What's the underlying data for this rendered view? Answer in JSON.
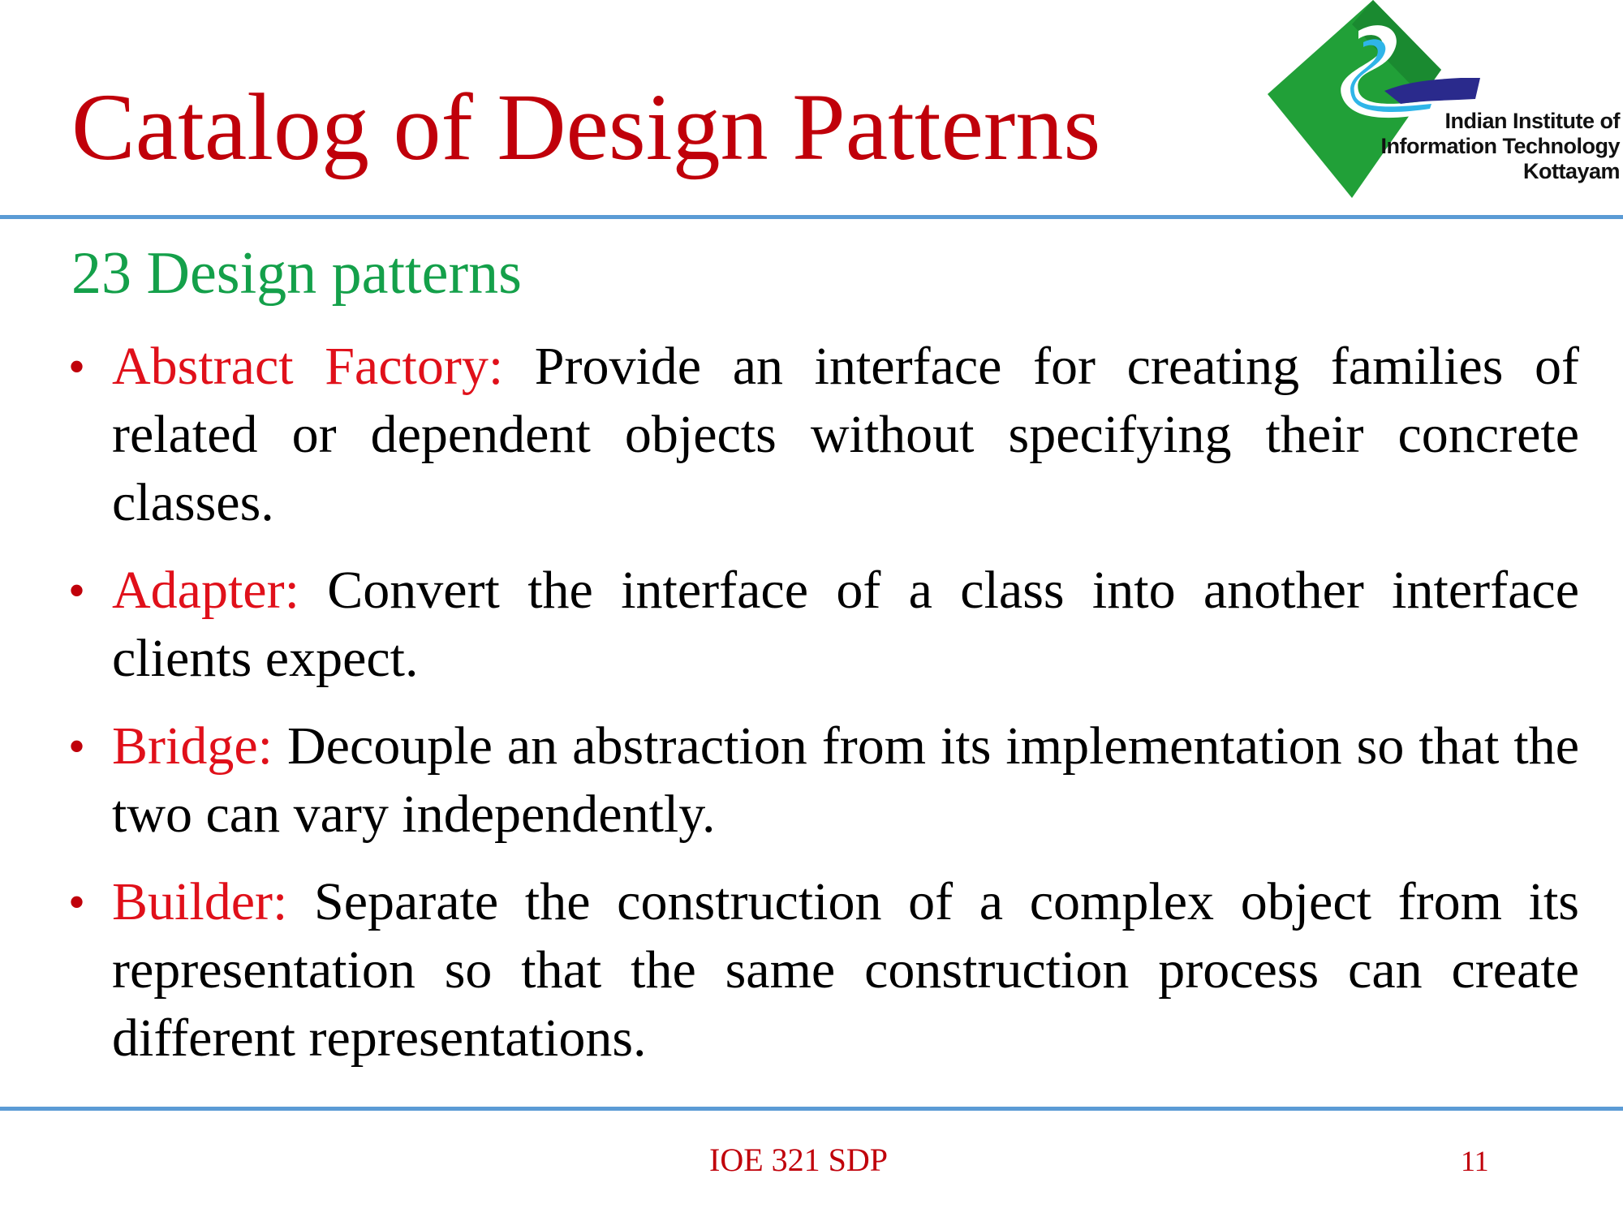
{
  "slide": {
    "title": "Catalog of  Design Patterns",
    "subtitle": "23 Design patterns",
    "logo": {
      "line1": "Indian Institute of",
      "line2": "Information Technology",
      "line3": "Kottayam"
    },
    "bullets": [
      {
        "term": "Abstract Factory:",
        "text": " Provide an interface for creating families of related or dependent objects without specifying their concrete classes."
      },
      {
        "term": "Adapter:",
        "text": " Convert the interface of a class into another interface clients expect."
      },
      {
        "term": "Bridge:",
        "text": " Decouple an abstraction from its implementation so that the two can vary independently."
      },
      {
        "term": "Builder:",
        "text": "  Separate the construction of a complex object from its representation so that the same construction process can create different representations."
      }
    ],
    "footer": {
      "course": "IOE 321 SDP",
      "page_number": "11"
    },
    "colors": {
      "title": "#c0000a",
      "subtitle": "#14a04a",
      "term": "#e0101a",
      "rule": "#5b9bd5"
    }
  }
}
